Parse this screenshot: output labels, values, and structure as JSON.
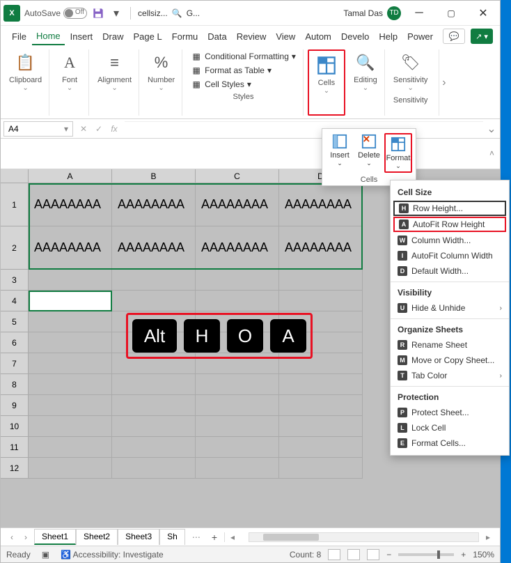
{
  "titlebar": {
    "autosave_label": "AutoSave",
    "autosave_off": "Off",
    "filename": "cellsiz...",
    "search_hint": "G...",
    "username": "Tamal Das",
    "initials": "TD"
  },
  "tabs": [
    "File",
    "Home",
    "Insert",
    "Draw",
    "Page L",
    "Formu",
    "Data",
    "Review",
    "View",
    "Autom",
    "Develo",
    "Help",
    "Power"
  ],
  "active_tab": "Home",
  "ribbon": {
    "groups": [
      "Clipboard",
      "Font",
      "Alignment",
      "Number",
      "Cells",
      "Editing",
      "Sensitivity"
    ],
    "styles": {
      "cond_fmt": "Conditional Formatting",
      "format_table": "Format as Table",
      "cell_styles": "Cell Styles",
      "label": "Styles"
    },
    "sensitivity_label": "Sensitivity"
  },
  "cells_panel": {
    "items": [
      "Insert",
      "Delete",
      "Format"
    ],
    "label": "Cells"
  },
  "format_menu": {
    "sections": {
      "cell_size": "Cell Size",
      "visibility": "Visibility",
      "organize": "Organize Sheets",
      "protection": "Protection"
    },
    "items": {
      "row_height": "Row Height...",
      "autofit_row": "AutoFit Row Height",
      "col_width": "Column Width...",
      "autofit_col": "AutoFit Column Width",
      "default_width": "Default Width...",
      "hide_unhide": "Hide & Unhide",
      "rename": "Rename Sheet",
      "move_copy": "Move or Copy Sheet...",
      "tab_color": "Tab Color",
      "protect": "Protect Sheet...",
      "lock": "Lock Cell",
      "format_cells": "Format Cells..."
    },
    "keys": {
      "row_height": "H",
      "autofit_row": "A",
      "col_width": "W",
      "autofit_col": "I",
      "default_width": "D",
      "hide_unhide": "U",
      "rename": "R",
      "move_copy": "M",
      "tab_color": "T",
      "protect": "P",
      "lock": "L",
      "format_cells": "E"
    }
  },
  "namebox": "A4",
  "columns": [
    "A",
    "B",
    "C",
    "D"
  ],
  "rows": [
    1,
    2,
    3,
    4,
    5,
    6,
    7,
    8,
    9,
    10,
    11,
    12
  ],
  "tall_rows": [
    1,
    2
  ],
  "cell_value": "AAAAAAAA",
  "kbd": [
    "Alt",
    "H",
    "O",
    "A"
  ],
  "sheets": [
    "Sheet1",
    "Sheet2",
    "Sheet3",
    "Sh"
  ],
  "active_sheet": 0,
  "status": {
    "ready": "Ready",
    "accessibility": "Accessibility: Investigate",
    "count": "Count: 8",
    "zoom": "150%"
  }
}
